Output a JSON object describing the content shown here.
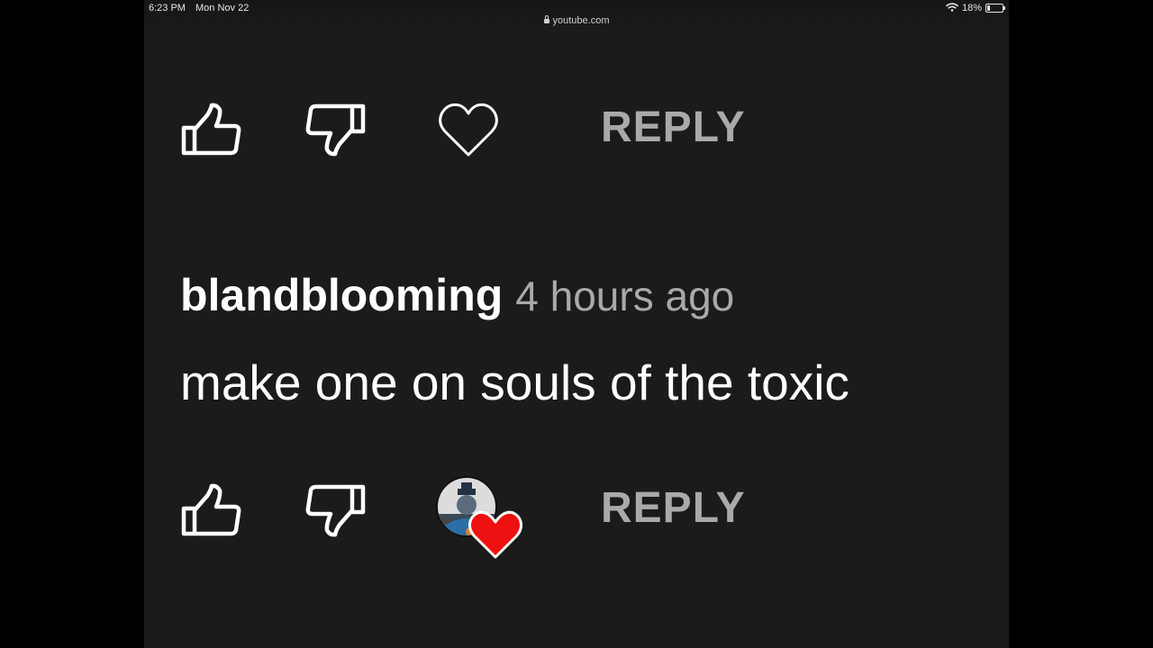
{
  "status_bar": {
    "time": "6:23 PM",
    "date": "Mon Nov 22",
    "url": "youtube.com",
    "battery_percent_label": "18%",
    "battery_level": 0.18,
    "icons": [
      "wifi-icon",
      "battery-icon",
      "lock-icon"
    ]
  },
  "previous_comment_actions": {
    "like_icon": "thumbs-up-icon",
    "dislike_icon": "thumbs-down-icon",
    "heart_icon": "heart-outline-icon",
    "reply_label": "REPLY"
  },
  "comment": {
    "author": "blandblooming",
    "time": "4 hours ago",
    "text": "make one on souls of the toxic",
    "actions": {
      "like_icon": "thumbs-up-icon",
      "dislike_icon": "thumbs-down-icon",
      "creator_heart_icon": "creator-heart-icon",
      "reply_label": "REPLY"
    }
  },
  "colors": {
    "background": "#1b1b1b",
    "text_primary": "#ffffff",
    "text_secondary": "#a9a9a9",
    "heart_red": "#ee1111"
  }
}
